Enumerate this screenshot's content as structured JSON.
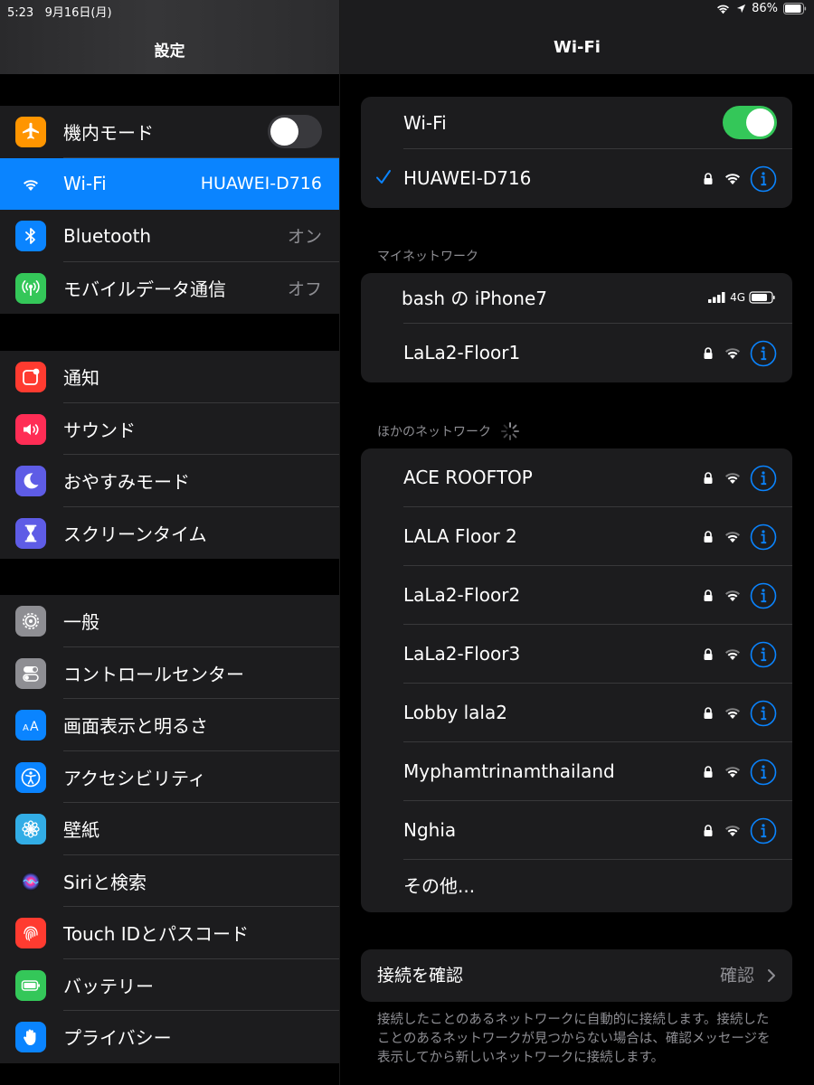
{
  "status_bar": {
    "time": "5:23",
    "date": "9月16日(月)",
    "battery": "86%"
  },
  "sidebar": {
    "title": "設定",
    "groups": [
      [
        {
          "label": "機内モード",
          "icon": "airplane-icon",
          "color": "#ff9500",
          "toggle": "off"
        },
        {
          "label": "Wi-Fi",
          "icon": "wifi-icon",
          "color": "#0a84ff",
          "value": "HUAWEI-D716",
          "selected": true
        },
        {
          "label": "Bluetooth",
          "icon": "bluetooth-icon",
          "color": "#0a84ff",
          "value": "オン"
        },
        {
          "label": "モバイルデータ通信",
          "icon": "antenna-icon",
          "color": "#34c759",
          "value": "オフ"
        }
      ],
      [
        {
          "label": "通知",
          "icon": "notification-icon",
          "color": "#ff3b30"
        },
        {
          "label": "サウンド",
          "icon": "speaker-icon",
          "color": "#ff2d55"
        },
        {
          "label": "おやすみモード",
          "icon": "moon-icon",
          "color": "#5e5ce6"
        },
        {
          "label": "スクリーンタイム",
          "icon": "hourglass-icon",
          "color": "#5e5ce6"
        }
      ],
      [
        {
          "label": "一般",
          "icon": "gear-icon",
          "color": "#8e8e93"
        },
        {
          "label": "コントロールセンター",
          "icon": "switches-icon",
          "color": "#8e8e93"
        },
        {
          "label": "画面表示と明るさ",
          "icon": "text-size-icon",
          "color": "#0a84ff"
        },
        {
          "label": "アクセシビリティ",
          "icon": "accessibility-icon",
          "color": "#0a84ff"
        },
        {
          "label": "壁紙",
          "icon": "flower-icon",
          "color": "#32ade6"
        },
        {
          "label": "Siriと検索",
          "icon": "siri-icon",
          "color": "#1c1c1e"
        },
        {
          "label": "Touch IDとパスコード",
          "icon": "fingerprint-icon",
          "color": "#ff3b30"
        },
        {
          "label": "バッテリー",
          "icon": "battery-icon",
          "color": "#34c759"
        },
        {
          "label": "プライバシー",
          "icon": "hand-icon",
          "color": "#0a84ff"
        }
      ]
    ]
  },
  "detail": {
    "title": "Wi-Fi",
    "wifi_label": "Wi-Fi",
    "wifi_toggle": "on",
    "connected_network": "HUAWEI-D716",
    "my_networks_header": "マイネットワーク",
    "hotspot": {
      "name": "bash の iPhone7",
      "network_type": "4G"
    },
    "my_networks": [
      "LaLa2-Floor1"
    ],
    "other_networks_header": "ほかのネットワーク",
    "other_networks": [
      "ACE ROOFTOP",
      "LALA Floor 2",
      "LaLa2-Floor2",
      "LaLa2-Floor3",
      "Lobby lala2",
      "Myphamtrinamthailand",
      "Nghia"
    ],
    "other_label": "その他...",
    "ask_to_join": {
      "label": "接続を確認",
      "value": "確認"
    },
    "footnote": "接続したことのあるネットワークに自動的に接続します。接続したことのあるネットワークが見つからない場合は、確認メッセージを表示してから新しいネットワークに接続します。"
  }
}
